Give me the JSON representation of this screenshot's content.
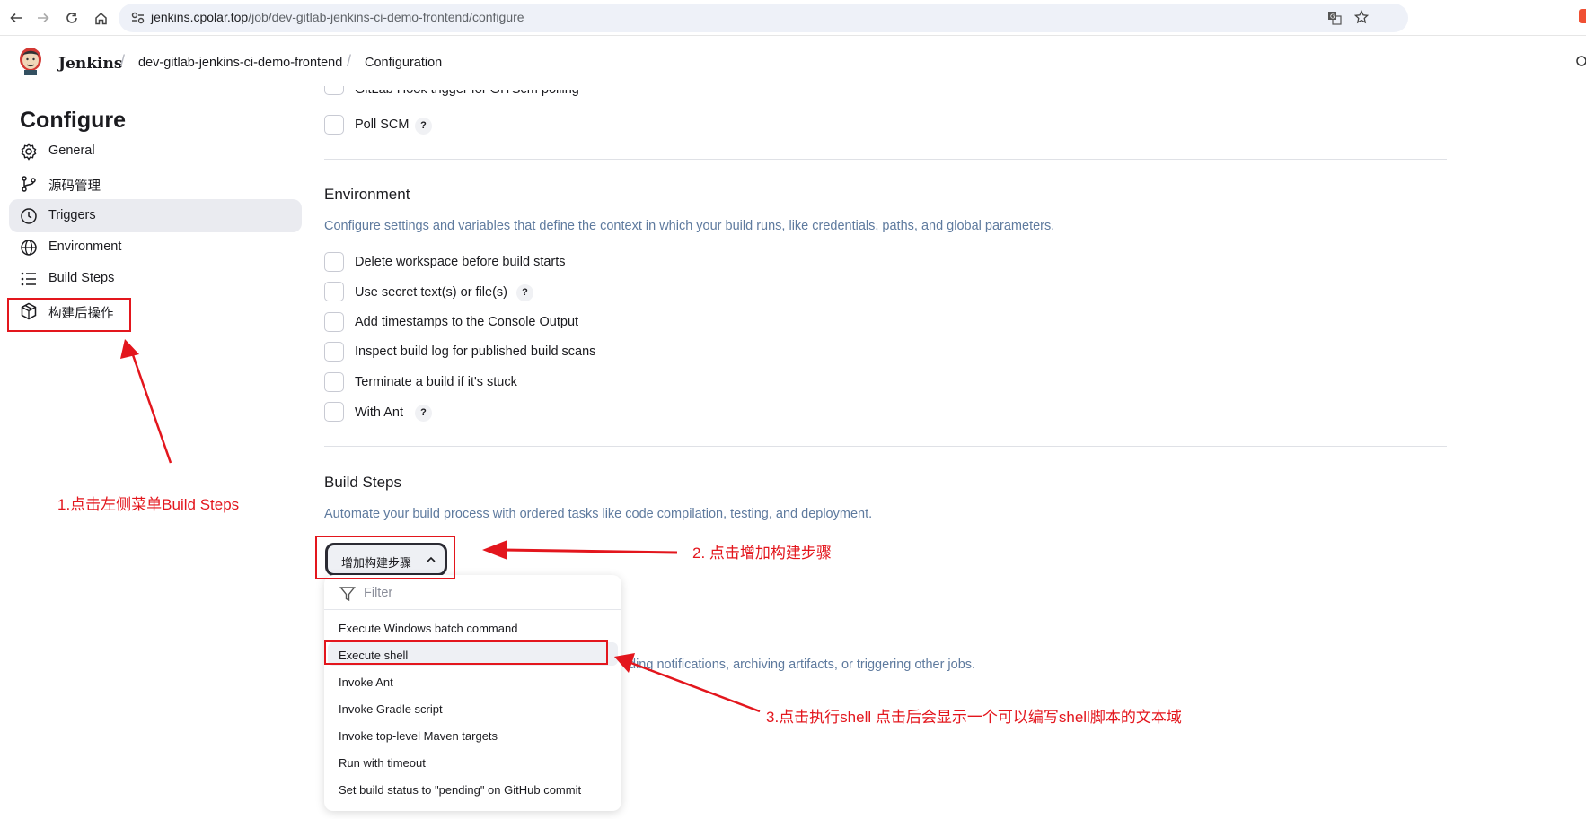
{
  "browser": {
    "url_host": "jenkins.cpolar.top",
    "url_path": "/job/dev-gitlab-jenkins-ci-demo-frontend/configure"
  },
  "header": {
    "brand": "Jenkins",
    "breadcrumbs": [
      "dev-gitlab-jenkins-ci-demo-frontend",
      "Configuration"
    ]
  },
  "sidebar": {
    "title": "Configure",
    "items": [
      {
        "label": "General",
        "icon": "gear-icon"
      },
      {
        "label": "源码管理",
        "icon": "git-branch-icon"
      },
      {
        "label": "Triggers",
        "icon": "clock-icon",
        "active": true
      },
      {
        "label": "Environment",
        "icon": "globe-icon"
      },
      {
        "label": "Build Steps",
        "icon": "list-icon"
      },
      {
        "label": "构建后操作",
        "icon": "package-icon"
      }
    ]
  },
  "triggers": {
    "partial_item": "GitLab Hook trigger for GITScm polling",
    "poll_scm": "Poll SCM",
    "help": "?"
  },
  "environment": {
    "title": "Environment",
    "description": "Configure settings and variables that define the context in which your build runs, like credentials, paths, and global parameters.",
    "options": [
      {
        "label": "Delete workspace before build starts",
        "help": false
      },
      {
        "label": "Use secret text(s) or file(s)",
        "help": true
      },
      {
        "label": "Add timestamps to the Console Output",
        "help": false
      },
      {
        "label": "Inspect build log for published build scans",
        "help": false
      },
      {
        "label": "Terminate a build if it's stuck",
        "help": false
      },
      {
        "label": "With Ant",
        "help": true
      }
    ]
  },
  "build_steps": {
    "title": "Build Steps",
    "description": "Automate your build process with ordered tasks like code compilation, testing, and deployment.",
    "add_button": "增加构建步骤",
    "filter_placeholder": "Filter",
    "menu_items": [
      "Execute Windows batch command",
      "Execute shell",
      "Invoke Ant",
      "Invoke Gradle script",
      "Invoke top-level Maven targets",
      "Run with timeout",
      "Set build status to \"pending\" on GitHub commit"
    ]
  },
  "post_build": {
    "partial_description": "ding notifications, archiving artifacts, or triggering other jobs."
  },
  "annotations": {
    "step1": "1.点击左侧菜单Build Steps",
    "step2": "2. 点击增加构建步骤",
    "step3": "3.点击执行shell  点击后会显示一个可以编写shell脚本的文本域",
    "color": "#e3161d"
  }
}
